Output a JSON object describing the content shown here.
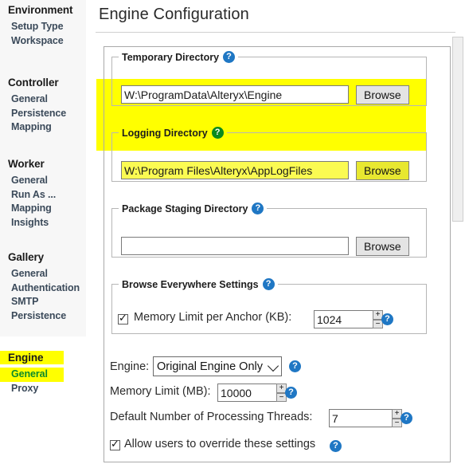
{
  "sidebar": {
    "groups": [
      {
        "header": "Environment",
        "items": [
          {
            "label": "Setup Type",
            "selected": false
          },
          {
            "label": "Workspace",
            "selected": false
          }
        ]
      },
      {
        "header": "Controller",
        "items": [
          {
            "label": "General",
            "selected": false
          },
          {
            "label": "Persistence",
            "selected": false
          },
          {
            "label": "Mapping",
            "selected": false
          }
        ]
      },
      {
        "header": "Worker",
        "items": [
          {
            "label": "General",
            "selected": false
          },
          {
            "label": "Run As ...",
            "selected": false
          },
          {
            "label": "Mapping",
            "selected": false
          },
          {
            "label": "Insights",
            "selected": false
          }
        ]
      },
      {
        "header": "Gallery",
        "items": [
          {
            "label": "General",
            "selected": false
          },
          {
            "label": "Authentication",
            "selected": false
          },
          {
            "label": "SMTP",
            "selected": false
          },
          {
            "label": "Persistence",
            "selected": false
          }
        ]
      },
      {
        "header": "Engine",
        "highlighted": true,
        "items": [
          {
            "label": "General",
            "selected": true,
            "highlighted": true
          },
          {
            "label": "Proxy",
            "selected": false
          }
        ]
      }
    ]
  },
  "header": {
    "title": "Engine Configuration"
  },
  "groups": {
    "temporary_directory": {
      "legend": "Temporary Directory",
      "help_icon": "help-question-icon",
      "value": "W:\\ProgramData\\Alteryx\\Engine",
      "browse_label": "Browse"
    },
    "logging_directory": {
      "legend": "Logging Directory",
      "help_icon": "help-question-icon",
      "value": "W:\\Program Files\\Alteryx\\AppLogFiles",
      "browse_label": "Browse",
      "highlight_color": "#ffff00"
    },
    "package_staging_directory": {
      "legend": "Package Staging Directory",
      "help_icon": "help-question-icon",
      "value": "",
      "browse_label": "Browse"
    },
    "browse_everywhere": {
      "legend": "Browse Everywhere Settings",
      "help_icon": "help-question-icon",
      "memory_limit_label": "Memory Limit per Anchor (KB):",
      "memory_limit_value": "1024",
      "memory_limit_checked": true
    }
  },
  "settings": {
    "engine_label": "Engine:",
    "engine_value": "Original Engine Only",
    "engine_options": [
      "Original Engine Only"
    ],
    "memory_limit_label": "Memory Limit (MB):",
    "memory_limit_value": "10000",
    "threads_label": "Default Number of Processing Threads:",
    "threads_value": "7",
    "override_label": "Allow users to override these settings",
    "override_checked": true
  },
  "icons": {
    "help": "?",
    "spin_up": "+",
    "spin_down": "−"
  },
  "colors": {
    "accent_blue": "#1f77c4",
    "highlight_yellow": "#ffff00",
    "selected_green": "#0b8a2a"
  }
}
